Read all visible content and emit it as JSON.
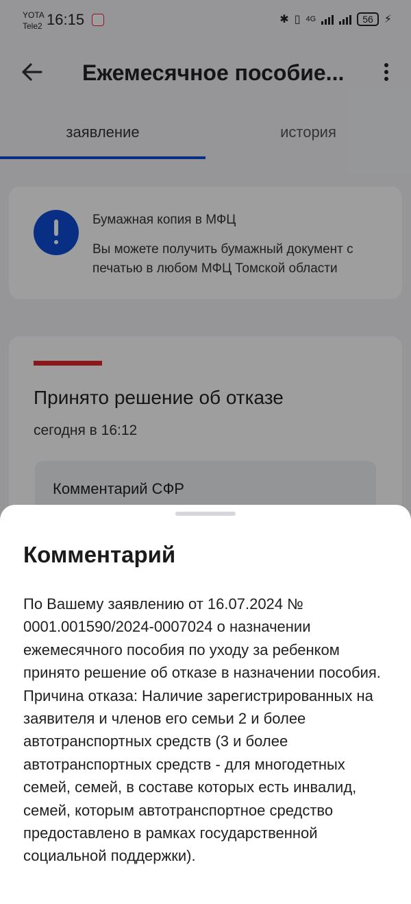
{
  "status_bar": {
    "carrier_1": "YOTA",
    "carrier_2": "Tele2",
    "time": "16:15",
    "network_type": "4G",
    "battery": "56"
  },
  "app_bar": {
    "title": "Ежемесячное пособие..."
  },
  "tabs": [
    {
      "label": "заявление",
      "active": true
    },
    {
      "label": "история",
      "active": false
    }
  ],
  "info_card": {
    "title": "Бумажная копия в МФЦ",
    "text": "Вы можете получить бумажный документ с печатью в любом МФЦ  Томской области"
  },
  "status_card": {
    "title": "Принято решение об отказе",
    "time": "сегодня в 16:12",
    "comment_label": "Комментарий СФР"
  },
  "sheet": {
    "title": "Комментарий",
    "text": "По Вашему заявлению от 16.07.2024 № 0001.001590/2024-0007024 о назначении ежемесячного пособия по уходу за ребенком принято решение об отказе в назначении пособия. Причина отказа: Наличие зарегистрированных на заявителя и членов его семьи 2 и более автотранспортных средств (3 и более автотранспортных средств - для многодетных семей, семей, в составе которых есть инвалид, семей, которым автотранспортное средство предоставлено в рамках государственной социальной поддержки)."
  },
  "colors": {
    "primary": "#0d4cd3",
    "error": "#e1262c",
    "background": "#f2f3f6"
  }
}
